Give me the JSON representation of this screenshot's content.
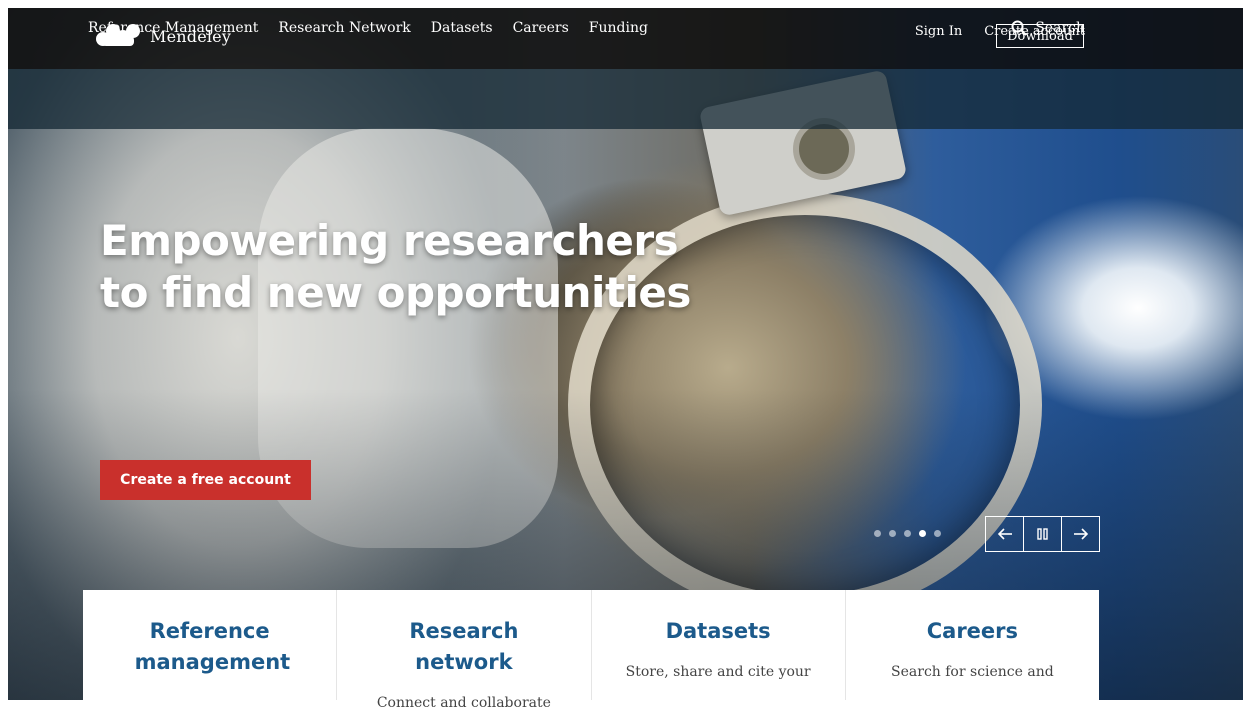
{
  "header": {
    "brand": "Mendeley",
    "sign_in": "Sign In",
    "create_account": "Create account",
    "download": "Download"
  },
  "nav": {
    "items": [
      "Reference Management",
      "Research Network",
      "Datasets",
      "Careers",
      "Funding"
    ],
    "search_label": "Search"
  },
  "hero": {
    "headline_line1": "Empowering researchers",
    "headline_line2": "to find new opportunities",
    "cta_label": "Create a free account",
    "carousel": {
      "slide_count": 5,
      "active_index": 3,
      "prev_icon": "arrow-left-icon",
      "pause_icon": "pause-icon",
      "next_icon": "arrow-right-icon"
    }
  },
  "cards": [
    {
      "title": "Reference management",
      "text": ""
    },
    {
      "title": "Research network",
      "text": "Connect and collaborate"
    },
    {
      "title": "Datasets",
      "text": "Store, share and cite your"
    },
    {
      "title": "Careers",
      "text": "Search for science and"
    }
  ],
  "colors": {
    "cta": "#c9302c",
    "card_title": "#1c5a8b",
    "topbar": "#0c0c0c"
  }
}
